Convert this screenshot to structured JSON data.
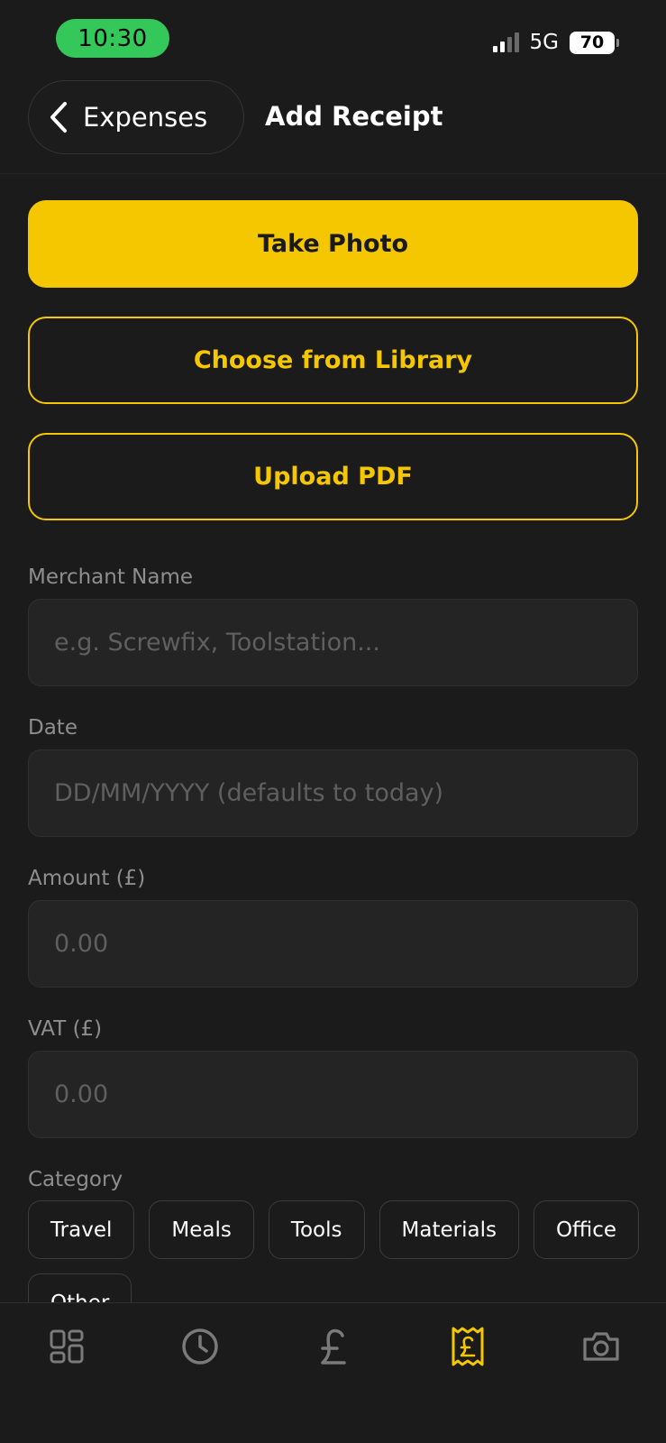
{
  "status_bar": {
    "time": "10:30",
    "network": "5G",
    "battery": "70"
  },
  "header": {
    "back_label": "Expenses",
    "title": "Add Receipt"
  },
  "actions": {
    "take_photo": "Take Photo",
    "choose_library": "Choose from Library",
    "upload_pdf": "Upload PDF"
  },
  "form": {
    "merchant": {
      "label": "Merchant Name",
      "placeholder": "e.g. Screwfix, Toolstation...",
      "value": ""
    },
    "date": {
      "label": "Date",
      "placeholder": "DD/MM/YYYY (defaults to today)",
      "value": ""
    },
    "amount": {
      "label": "Amount (£)",
      "placeholder": "0.00",
      "value": ""
    },
    "vat": {
      "label": "VAT (£)",
      "placeholder": "0.00",
      "value": ""
    },
    "category": {
      "label": "Category",
      "options": [
        "Travel",
        "Meals",
        "Tools",
        "Materials",
        "Office",
        "Other"
      ]
    }
  },
  "tabbar": {
    "items": [
      {
        "icon": "dashboard-icon",
        "active": false
      },
      {
        "icon": "clock-icon",
        "active": false
      },
      {
        "icon": "pound-icon",
        "active": false
      },
      {
        "icon": "receipt-icon",
        "active": true
      },
      {
        "icon": "camera-icon",
        "active": false
      }
    ]
  },
  "colors": {
    "accent": "#f5c700",
    "background": "#1b1b1b",
    "field_bg": "#242424",
    "muted_text": "#8e8e8e",
    "inactive_icon": "#7a7a7a",
    "status_pill": "#34c759"
  }
}
